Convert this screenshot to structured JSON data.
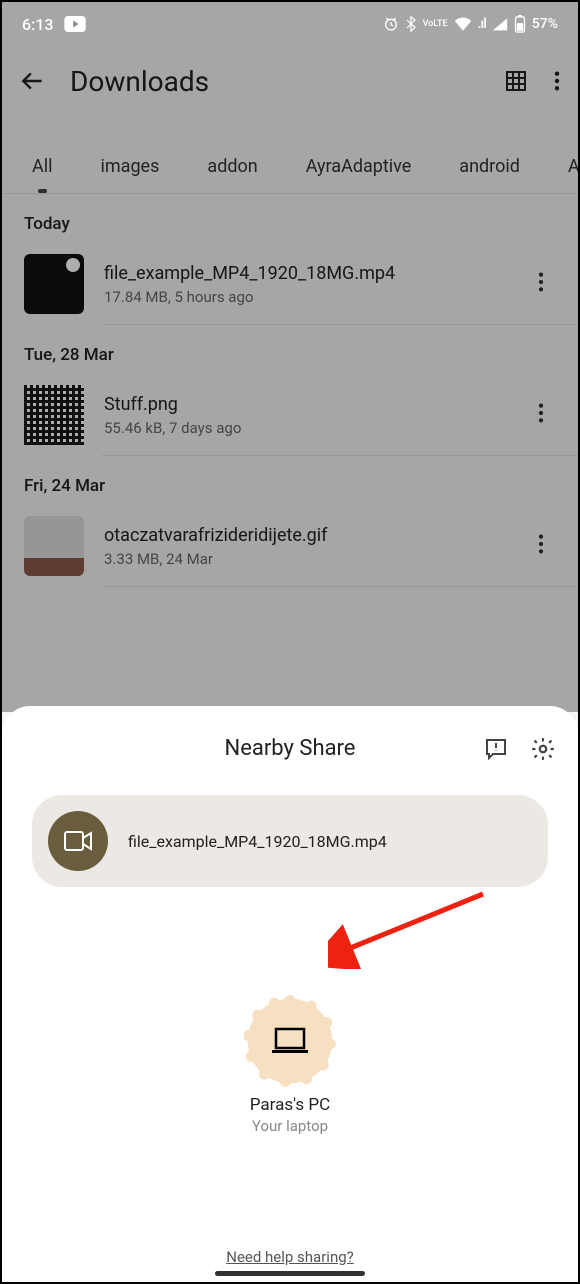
{
  "status": {
    "time": "6:13",
    "battery": "57%"
  },
  "appbar": {
    "title": "Downloads"
  },
  "tabs": [
    "All",
    "images",
    "addon",
    "AyraAdaptive",
    "android",
    "AyraLa"
  ],
  "sections": [
    {
      "header": "Today",
      "files": [
        {
          "name": "file_example_MP4_1920_18MG.mp4",
          "meta": "17.84 MB, 5 hours ago",
          "thumb": "video"
        }
      ]
    },
    {
      "header": "Tue, 28 Mar",
      "files": [
        {
          "name": "Stuff.png",
          "meta": "55.46 kB, 7 days ago",
          "thumb": "qrcode"
        }
      ]
    },
    {
      "header": "Fri, 24 Mar",
      "files": [
        {
          "name": "otaczatvarafrizideridijete.gif",
          "meta": "3.33 MB, 24 Mar",
          "thumb": "photo"
        }
      ]
    }
  ],
  "sheet": {
    "title": "Nearby Share",
    "file": "file_example_MP4_1920_18MG.mp4",
    "device": {
      "name": "Paras's PC",
      "sub": "Your laptop"
    },
    "help": "Need help sharing?"
  }
}
